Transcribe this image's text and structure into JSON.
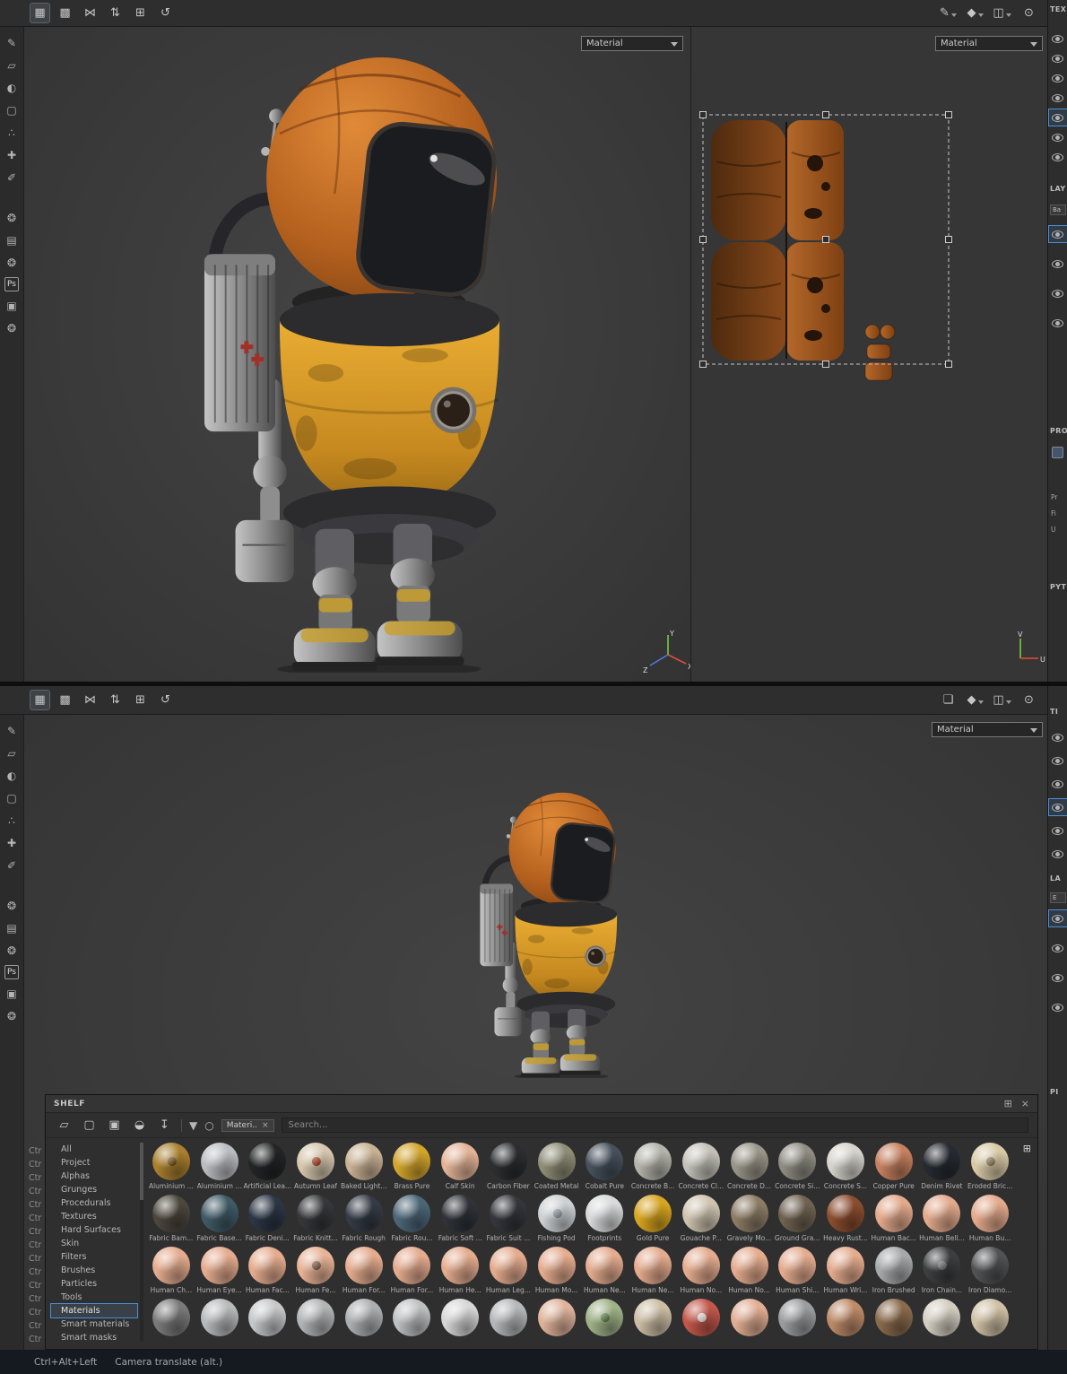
{
  "colors": {
    "accent_blue": "#4a90d9",
    "robot_orange": "#c9742c",
    "robot_yellow": "#dca32f",
    "uv_orange": "#b5682a",
    "viewport_bg": "#3c3c3c",
    "status_bg": "#151a21"
  },
  "toolbar": {
    "left_icons": [
      {
        "name": "paint-mode-icon",
        "glyph": "▦",
        "selected": true
      },
      {
        "name": "render-grid-icon",
        "glyph": "▩"
      },
      {
        "name": "symmetry-icon",
        "glyph": "⋈"
      },
      {
        "name": "mirror-flip-icon",
        "glyph": "⇅"
      },
      {
        "name": "add-texture-set-icon",
        "glyph": "⊞"
      },
      {
        "name": "history-icon",
        "glyph": "↺"
      }
    ],
    "right_icons_top": [
      {
        "name": "rename-icon",
        "glyph": "✎",
        "caret": true
      },
      {
        "name": "shader-icon",
        "glyph": "◆",
        "caret": true
      },
      {
        "name": "camera-icon",
        "glyph": "◫",
        "caret": true
      },
      {
        "name": "screenshot-icon",
        "glyph": "⊙"
      }
    ],
    "right_icons_bottom": [
      {
        "name": "comment-icon",
        "glyph": "❏"
      },
      {
        "name": "shader-icon",
        "glyph": "◆",
        "caret": true
      },
      {
        "name": "camera-icon",
        "glyph": "◫",
        "caret": true
      },
      {
        "name": "screenshot-icon",
        "glyph": "⊙"
      }
    ]
  },
  "left_tools": [
    {
      "name": "paint-tool-icon",
      "glyph": "✎"
    },
    {
      "name": "eraser-tool-icon",
      "glyph": "▱"
    },
    {
      "name": "projection-tool-icon",
      "glyph": "◐"
    },
    {
      "name": "polygon-fill-tool-icon",
      "glyph": "▢"
    },
    {
      "name": "particles-tool-icon",
      "glyph": "∴"
    },
    {
      "name": "physical-paint-tool-icon",
      "glyph": "✚"
    },
    {
      "name": "material-picker-tool-icon",
      "glyph": "✐"
    },
    {
      "sep": true
    },
    {
      "name": "tool-settings-icon",
      "glyph": "❂"
    },
    {
      "name": "display-settings-icon",
      "glyph": "▤"
    },
    {
      "name": "shader-settings-icon",
      "glyph": "❂"
    },
    {
      "name": "photoshop-badge",
      "text": "Ps"
    },
    {
      "name": "iray-renderer-icon",
      "glyph": "▣"
    },
    {
      "name": "preferences-icon",
      "glyph": "❂"
    }
  ],
  "top_window": {
    "material_dropdown_3d": "Material",
    "material_dropdown_2d": "Material",
    "axis_3d": {
      "x": "X",
      "y": "Y",
      "z": "Z"
    },
    "axis_2d": {
      "u": "U",
      "v": "V"
    },
    "right_panel": {
      "section1_title": "TEX",
      "section2_title": "LAY",
      "dropdown_stub": "Ba",
      "section3_title": "PRO",
      "lines": [
        "Pr",
        "Fi",
        "U"
      ],
      "section4_title": "PYT"
    }
  },
  "bottom_window": {
    "material_dropdown": "Material",
    "right_panel": {
      "section1_title": "TI",
      "section2_title": "LA",
      "dropdown_stub": "E",
      "section3_title": "PI"
    }
  },
  "eyes": {
    "top1": {
      "count": 7,
      "selected": 4
    },
    "top2": {
      "count": 4,
      "selected": 0
    },
    "bottom1": {
      "count": 6,
      "selected": 3
    },
    "bottom2": {
      "count": 4,
      "selected": 0
    }
  },
  "shelf": {
    "title": "SHELF",
    "dock_icon": "⊞",
    "close_icon": "×",
    "toolbar_icons": [
      {
        "name": "open-folder-icon",
        "glyph": "▱"
      },
      {
        "name": "new-file-icon",
        "glyph": "▢"
      },
      {
        "name": "duplicate-icon",
        "glyph": "▣"
      },
      {
        "name": "hide-resources-icon",
        "glyph": "◒"
      },
      {
        "name": "import-resources-icon",
        "glyph": "↧"
      }
    ],
    "filter_icon": "▼",
    "link_icon": "○",
    "filter_chip": "Materi..",
    "chip_close": "×",
    "search_placeholder": "Search...",
    "thumb_size_icon": "⊞",
    "categories": [
      "All",
      "Project",
      "Alphas",
      "Grunges",
      "Procedurals",
      "Textures",
      "Hard Surfaces",
      "Skin",
      "Filters",
      "Brushes",
      "Particles",
      "Tools",
      "Materials",
      "Smart materials",
      "Smart masks"
    ],
    "selected_category": "Materials",
    "shortcut_column": [
      "Ctr",
      "Ctr",
      "Ctr",
      "Ctr",
      "Ctr",
      "Ctr",
      "Ctr",
      "Ctr",
      "Ctr",
      "Ctr",
      "Ctr",
      "Ctr",
      "Ctr",
      "Ctr",
      "Ctr"
    ],
    "materials": [
      [
        {
          "label": "Aluminium ...",
          "c": "#a87f2e",
          "a": "#6e4a12"
        },
        {
          "label": "Aluminium ...",
          "c": "#b9bcc0"
        },
        {
          "label": "Artificial Lea...",
          "c": "#232425"
        },
        {
          "label": "Autumn Leaf",
          "c": "#d6c6ae",
          "a": "#a8401e"
        },
        {
          "label": "Baked Light...",
          "c": "#c8b193"
        },
        {
          "label": "Brass Pure",
          "c": "#d2a42c"
        },
        {
          "label": "Calf Skin",
          "c": "#e2b396"
        },
        {
          "label": "Carbon Fiber",
          "c": "#2b2d30"
        },
        {
          "label": "Coated Metal",
          "c": "#8e8d76"
        },
        {
          "label": "Cobalt Pure",
          "c": "#46505c"
        },
        {
          "label": "Concrete B...",
          "c": "#b3b3aa"
        },
        {
          "label": "Concrete Cl...",
          "c": "#c3c1b8"
        },
        {
          "label": "Concrete D...",
          "c": "#999588"
        },
        {
          "label": "Concrete Si...",
          "c": "#8f8d83"
        },
        {
          "label": "Concrete S...",
          "c": "#d5d3cb"
        },
        {
          "label": "Copper Pure",
          "c": "#c5805f"
        },
        {
          "label": "Denim Rivet",
          "c": "#262a31"
        },
        {
          "label": "Eroded Bric...",
          "c": "#d8c9a6",
          "a": "#8a7a5a"
        }
      ],
      [
        {
          "label": "Fabric Bam...",
          "c": "#4c463d"
        },
        {
          "label": "Fabric Base...",
          "c": "#3f5a64"
        },
        {
          "label": "Fabric Deni...",
          "c": "#2c3644"
        },
        {
          "label": "Fabric Knitt...",
          "c": "#36373b"
        },
        {
          "label": "Fabric Rough",
          "c": "#343b45"
        },
        {
          "label": "Fabric Rou...",
          "c": "#4c6677"
        },
        {
          "label": "Fabric Soft ...",
          "c": "#2f3339"
        },
        {
          "label": "Fabric Suit ...",
          "c": "#33363c"
        },
        {
          "label": "Fishing Pod",
          "c": "#ccd0d3",
          "a": "#8a959d"
        },
        {
          "label": "Footprints",
          "c": "#d8d9da"
        },
        {
          "label": "Gold Pure",
          "c": "#d6a41f"
        },
        {
          "label": "Gouache P...",
          "c": "#cec4b0"
        },
        {
          "label": "Gravely Mo...",
          "c": "#8c7c65"
        },
        {
          "label": "Ground Gra...",
          "c": "#6e6250"
        },
        {
          "label": "Heavy Rust...",
          "c": "#8a4c2e"
        },
        {
          "label": "Human Bac...",
          "c": "#e2a98b"
        },
        {
          "label": "Human Bell...",
          "c": "#e2a98b"
        },
        {
          "label": "Human Bu...",
          "c": "#e2a98b"
        }
      ],
      [
        {
          "label": "Human Ch...",
          "c": "#e4ab8e"
        },
        {
          "label": "Human Eye...",
          "c": "#e4ab8e"
        },
        {
          "label": "Human Fac...",
          "c": "#e4ab8e"
        },
        {
          "label": "Human Fe...",
          "c": "#e8b295",
          "a": "#7a5a48"
        },
        {
          "label": "Human For...",
          "c": "#e4ab8e"
        },
        {
          "label": "Human For...",
          "c": "#e4ab8e"
        },
        {
          "label": "Human He...",
          "c": "#e4ab8e"
        },
        {
          "label": "Human Leg...",
          "c": "#e4ab8e"
        },
        {
          "label": "Human Mo...",
          "c": "#e4ab8e"
        },
        {
          "label": "Human Ne...",
          "c": "#e4ab8e"
        },
        {
          "label": "Human Ne...",
          "c": "#e4ab8e"
        },
        {
          "label": "Human No...",
          "c": "#e4ab8e"
        },
        {
          "label": "Human No...",
          "c": "#e4ab8e"
        },
        {
          "label": "Human Shi...",
          "c": "#e4ab8e"
        },
        {
          "label": "Human Wri...",
          "c": "#e4ab8e"
        },
        {
          "label": "Iron Brushed",
          "c": "#a6a8aa"
        },
        {
          "label": "Iron Chain...",
          "c": "#3c3e40",
          "a": "#6a6c6e"
        },
        {
          "label": "Iron Diamo...",
          "c": "#505254"
        }
      ],
      [
        {
          "label": "",
          "c": "#7a7a7a"
        },
        {
          "label": "",
          "c": "#b8b9bb"
        },
        {
          "label": "",
          "c": "#c6c7c9"
        },
        {
          "label": "",
          "c": "#b2b3b5"
        },
        {
          "label": "",
          "c": "#adaeb0"
        },
        {
          "label": "",
          "c": "#bfc0c2"
        },
        {
          "label": "",
          "c": "#d6d6d6"
        },
        {
          "label": "",
          "c": "#b6b7b9"
        },
        {
          "label": "",
          "c": "#dfb29a"
        },
        {
          "label": "",
          "c": "#9fb287",
          "a": "#5a7a3e"
        },
        {
          "label": "",
          "c": "#ccbda4"
        },
        {
          "label": "",
          "c": "#c2574a",
          "a": "#e8e4de"
        },
        {
          "label": "",
          "c": "#e1ad92"
        },
        {
          "label": "",
          "c": "#9b9c9e"
        },
        {
          "label": "",
          "c": "#bd8a68"
        },
        {
          "label": "",
          "c": "#8a6a4c"
        },
        {
          "label": "",
          "c": "#d4cec1"
        },
        {
          "label": "",
          "c": "#cfc0a4"
        }
      ]
    ]
  },
  "status_bar": {
    "shortcut": "Ctrl+Alt+Left",
    "action": "Camera translate (alt.)"
  }
}
